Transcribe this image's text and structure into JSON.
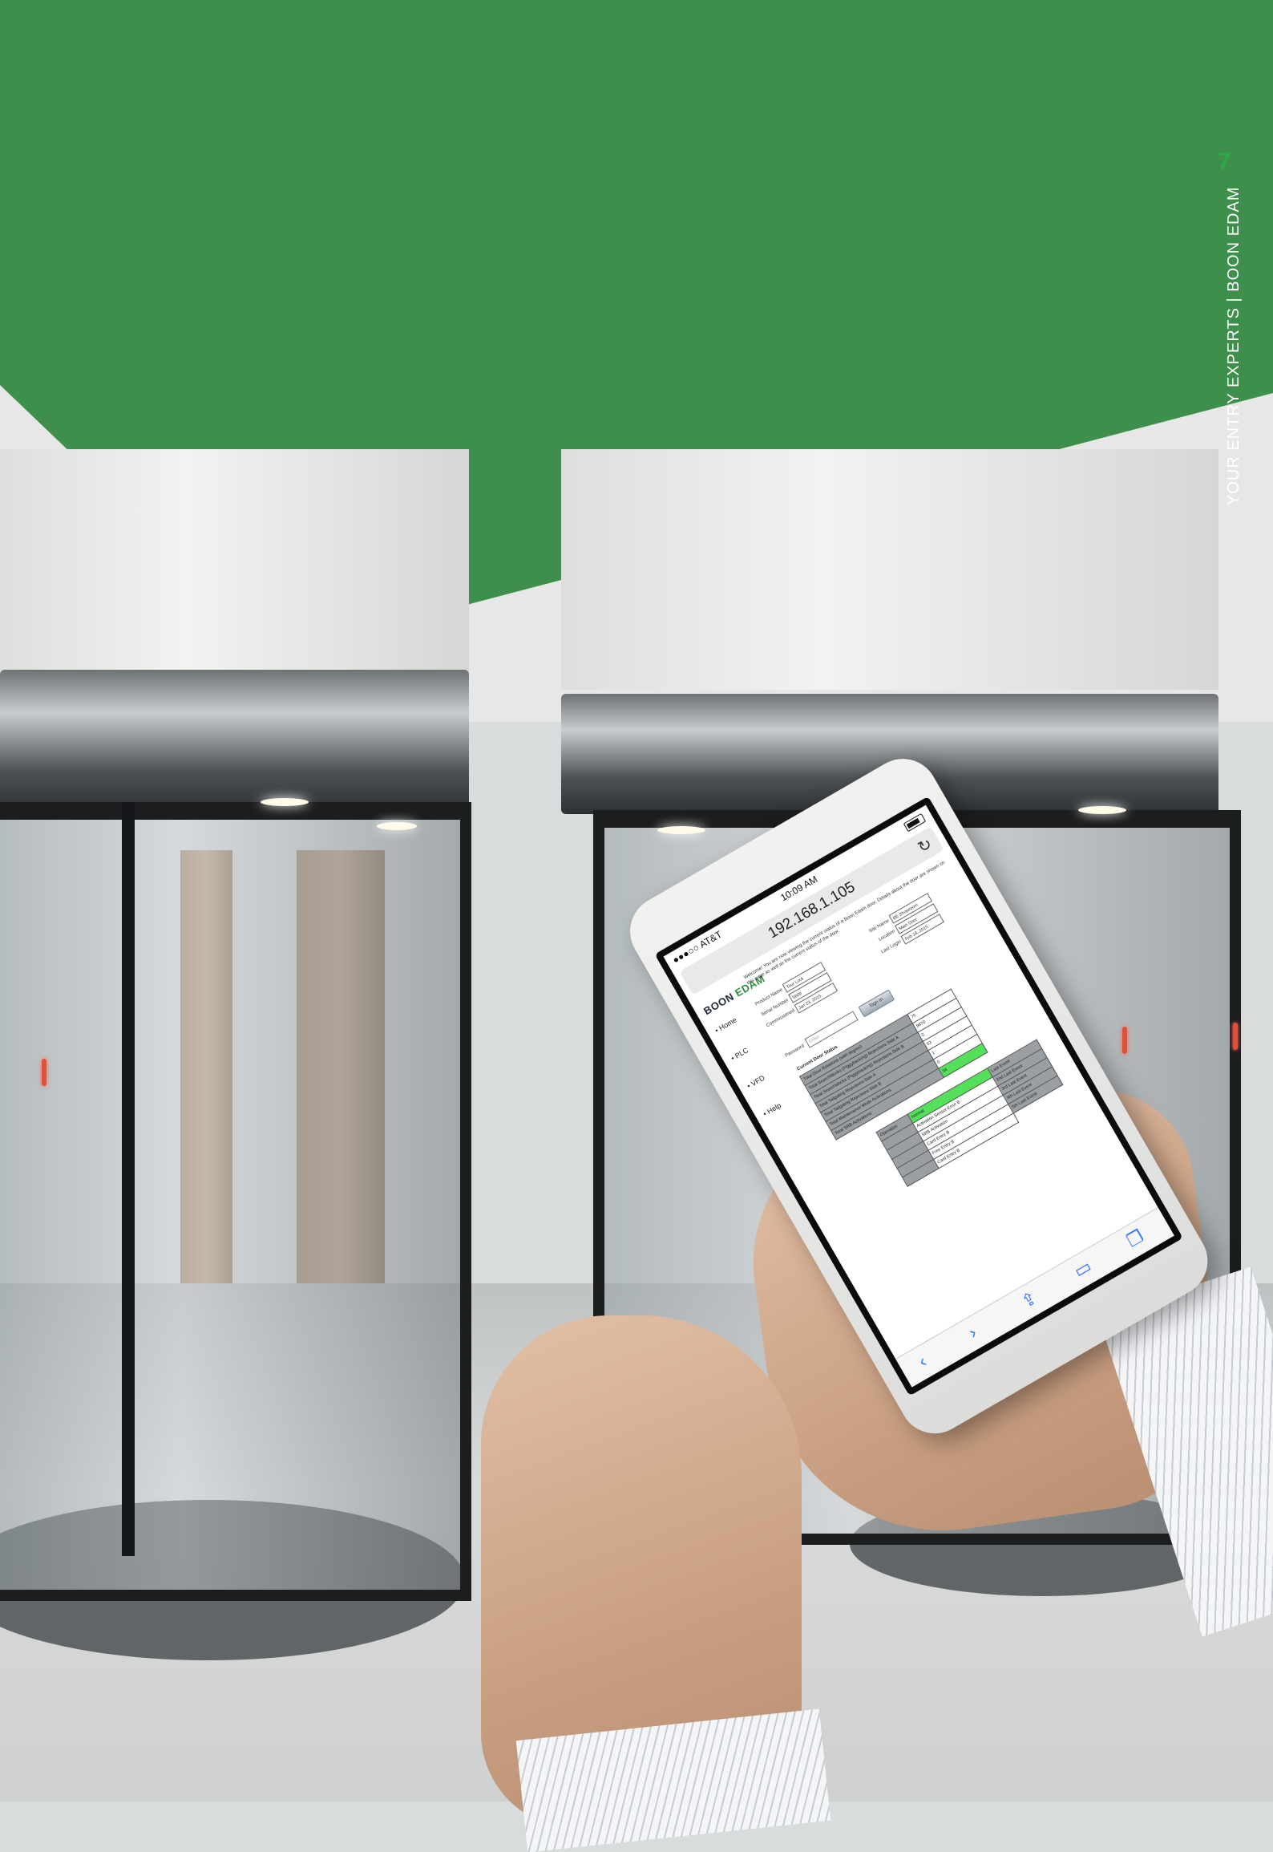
{
  "page": {
    "number": "7",
    "side_text": "YOUR ENTRY EXPERTS  |  BOON EDAM",
    "accent_color": "#3e8f4c"
  },
  "phone": {
    "status": {
      "carrier": "●●●○○ AT&T",
      "time": "10:09 AM"
    },
    "url": "192.168.1.105",
    "logo_a": "BOON ",
    "logo_b": "EDAM",
    "welcome": "Welcome! You are now viewing the current status of a Boon Edam door. Details about the door are shown on this page as well as the current status of the door.",
    "nav": [
      "Home",
      "PLC",
      "VFD",
      "Help"
    ],
    "info_left": [
      {
        "label": "Product Name",
        "value": "Tour Lock"
      },
      {
        "label": "Serial Number",
        "value": "5808"
      },
      {
        "label": "Commissioned",
        "value": "Jan 23, 2015"
      }
    ],
    "info_right": [
      {
        "label": "Site Name",
        "value": "BE Showroom"
      },
      {
        "label": "Location",
        "value": "Main Door"
      },
      {
        "label": "Last Login",
        "value": "Feb 18, 2015"
      }
    ],
    "password_label": "Password",
    "password_placeholder": "Enter",
    "signin_label": "Sign In",
    "status_title": "Current Door Status",
    "status_rows": [
      {
        "label": "Total Door Rotations (with degree)",
        "value": "75"
      },
      {
        "label": "Total Searchblocks (Piggybacking) Rejections Side A",
        "value": "9870"
      },
      {
        "label": "Total Searchblocks (Piggybacking) Rejections Side B",
        "value": "0"
      },
      {
        "label": "Total Tailgating Rejections Side A",
        "value": "53"
      },
      {
        "label": "Total Tailgating Rejections Side B",
        "value": "1"
      },
      {
        "label": "Total Maintenance Mode Activations",
        "value": "0"
      },
      {
        "label": "Total SRB Activations",
        "value": "34"
      }
    ],
    "events": [
      {
        "a": "Operation",
        "b": "Normal",
        "c": "Last Event"
      },
      {
        "a": "",
        "b": "Activation Sensor Error B",
        "c": "2nd Last Event"
      },
      {
        "a": "",
        "b": "SRB Activation",
        "c": "3rd Last Event"
      },
      {
        "a": "",
        "b": "Card Entry B",
        "c": "4th Last Event"
      },
      {
        "a": "",
        "b": "Free Entry B",
        "c": "5th Last Event"
      },
      {
        "a": "",
        "b": "Card Entry B",
        "c": ""
      }
    ],
    "toolbar": {
      "back": "‹",
      "forward": "›",
      "share": "⇪",
      "bookmarks": "▭",
      "tabs": "❐"
    }
  }
}
